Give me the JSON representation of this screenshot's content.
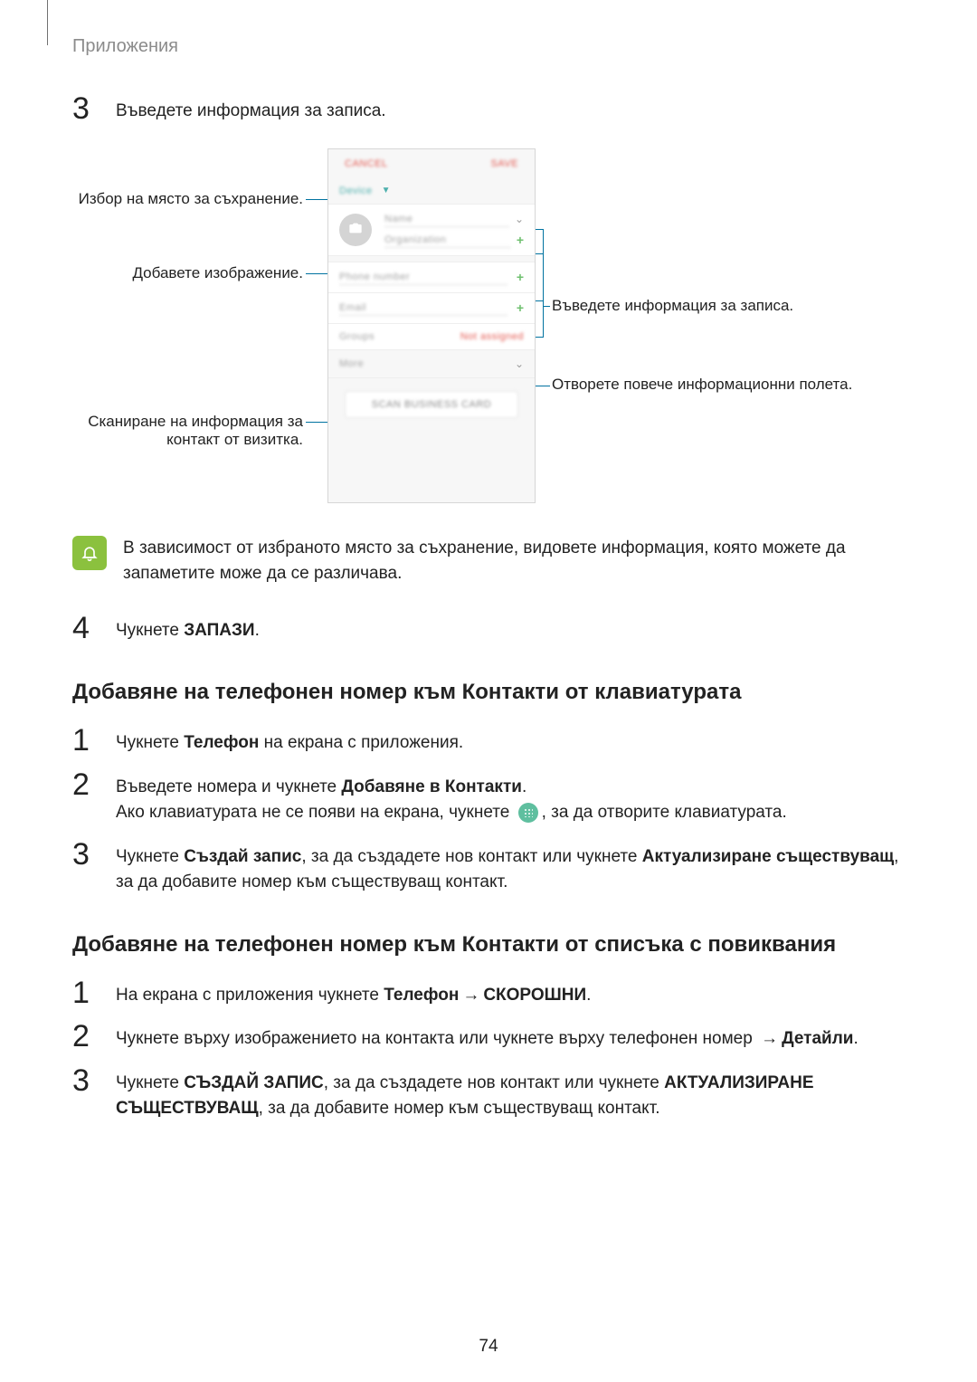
{
  "header": {
    "section": "Приложения"
  },
  "step3": {
    "num": "3",
    "text": "Въведете информация за записа."
  },
  "diagram": {
    "left": {
      "storage": "Избор на място за съхранение.",
      "image": "Добавете изображение.",
      "scan": "Сканиране на информация за контакт от визитка."
    },
    "right": {
      "enter": "Въведете информация за записа.",
      "more": "Отворете повече информационни полета."
    },
    "phone": {
      "cancel": "CANCEL",
      "save": "SAVE",
      "device": "Device",
      "name": "Name",
      "org": "Organization",
      "phone": "Phone number",
      "email": "Email",
      "groups": "Groups",
      "notassigned": "Not assigned",
      "more": "More",
      "scanbtn": "SCAN BUSINESS CARD"
    }
  },
  "note": {
    "text": "В зависимост от избраното място за съхранение, видовете информация, която можете да запаметите може да се различава."
  },
  "step4": {
    "num": "4",
    "pre": "Чукнете ",
    "bold": "ЗАПАЗИ",
    "post": "."
  },
  "sectionA": {
    "title": "Добавяне на телефонен номер към Контакти от клавиатурата",
    "s1": {
      "num": "1",
      "pre": "Чукнете ",
      "b1": "Телефон",
      "post": " на екрана с приложения."
    },
    "s2": {
      "num": "2",
      "l1_pre": "Въведете номера и чукнете ",
      "l1_b": "Добавяне в Контакти",
      "l1_post": ".",
      "l2_pre": "Ако клавиатурата не се появи на екрана, чукнете ",
      "l2_post": ", за да отворите клавиатурата."
    },
    "s3": {
      "num": "3",
      "pre": "Чукнете ",
      "b1": "Създай запис",
      "mid1": ", за да създадете нов контакт или чукнете ",
      "b2": "Актуализиране съществуващ",
      "post": ", за да добавите номер към съществуващ контакт."
    }
  },
  "sectionB": {
    "title": "Добавяне на телефонен номер към Контакти от списъка с повиквания",
    "s1": {
      "num": "1",
      "pre": "На екрана с приложения чукнете ",
      "b1": "Телефон",
      "arrow": " → ",
      "b2": "СКОРОШНИ",
      "post": "."
    },
    "s2": {
      "num": "2",
      "pre": "Чукнете върху изображението на контакта или чукнете върху телефонен номер ",
      "arrow": "→ ",
      "b1": "Детайли",
      "post": "."
    },
    "s3": {
      "num": "3",
      "pre": "Чукнете ",
      "b1": "СЪЗДАЙ ЗАПИС",
      "mid": ", за да създадете нов контакт или чукнете ",
      "b2": "АКТУАЛИЗИРАНЕ СЪЩЕСТВУВАЩ",
      "post": ", за да добавите номер към съществуващ контакт."
    }
  },
  "pagenum": "74"
}
